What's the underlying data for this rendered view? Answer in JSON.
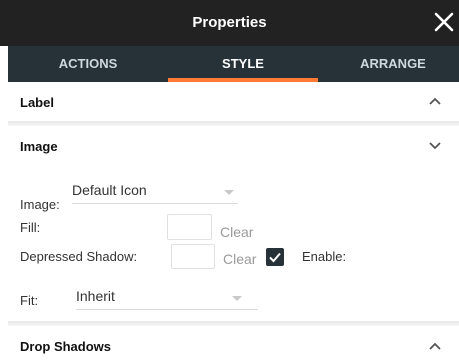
{
  "window": {
    "title": "Properties",
    "close_icon": "close-icon"
  },
  "tabs": [
    {
      "label": "ACTIONS",
      "active": false
    },
    {
      "label": "STYLE",
      "active": true
    },
    {
      "label": "ARRANGE",
      "active": false
    }
  ],
  "sections": {
    "label": {
      "title": "Label",
      "expanded": false,
      "chevron": "chevron-up-icon"
    },
    "image": {
      "title": "Image",
      "expanded": true,
      "chevron": "chevron-down-icon"
    },
    "drop_shadows": {
      "title": "Drop Shadows",
      "expanded": false,
      "chevron": "chevron-up-icon"
    }
  },
  "image_section": {
    "image_label": "Image:",
    "image_value": "Default Icon",
    "fill_label": "Fill:",
    "fill_clear": "Clear",
    "depressed_shadow_label": "Depressed Shadow:",
    "depressed_shadow_clear": "Clear",
    "enable_label": "Enable:",
    "enable_checked": true,
    "fit_label": "Fit:",
    "fit_value": "Inherit"
  },
  "colors": {
    "title_bar": "#222222",
    "tab_bar": "#263238",
    "accent": "#ff7a33",
    "checkbox": "#263238"
  }
}
